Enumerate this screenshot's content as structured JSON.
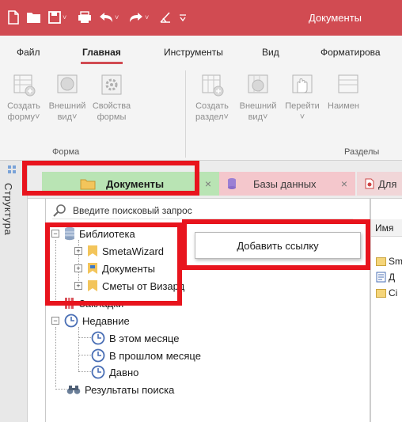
{
  "title_bar": {
    "title": "Документы",
    "quick_access": [
      "new-file-icon",
      "open-folder-icon",
      "save-icon",
      "print-icon",
      "undo-icon",
      "redo-icon",
      "clear-icon",
      "customize-icon"
    ]
  },
  "menu": {
    "tabs": [
      "Файл",
      "Главная",
      "Инструменты",
      "Вид",
      "Форматирова"
    ],
    "active": "Главная"
  },
  "ribbon": {
    "groups": [
      {
        "label": "Форма",
        "buttons": [
          {
            "label": "Создать\nформу˅",
            "icon": "create-form-icon"
          },
          {
            "label": "Внешний\nвид˅",
            "icon": "appearance-icon"
          },
          {
            "label": "Свойства\nформы",
            "icon": "properties-icon"
          }
        ]
      },
      {
        "label": "Разделы",
        "buttons": [
          {
            "label": "Создать\nраздел˅",
            "icon": "create-section-icon"
          },
          {
            "label": "Внешний\nвид˅",
            "icon": "appearance-icon"
          },
          {
            "label": "Перейти\n˅",
            "icon": "go-to-icon"
          },
          {
            "label": "Наимен",
            "icon": "name-icon"
          }
        ]
      }
    ]
  },
  "side_panel": {
    "label": "Структура"
  },
  "tabs": [
    {
      "label": "Документы",
      "close": "×",
      "active": true,
      "color": "#b9e4b4"
    },
    {
      "label": "Базы данных",
      "close": "×",
      "active": false,
      "color": "#f4c7cc"
    },
    {
      "label": "Для",
      "active": false,
      "color": "#f1d6d8"
    }
  ],
  "search": {
    "placeholder": "Введите поисковый запрос"
  },
  "tree": {
    "library": "Библиотека",
    "smeta": "SmetaWizard",
    "documents": "Документы",
    "smety": "Сметы от Визард",
    "bookmarks": "Закладки",
    "recent": "Недавние",
    "this_month": "В этом месяце",
    "last_month": "В прошлом месяце",
    "long_ago": "Давно",
    "search_results": "Результаты поиска"
  },
  "list": {
    "header": "Имя",
    "items": [
      "Sm",
      "Д",
      "Сі"
    ]
  },
  "popup": {
    "label": "Добавить ссылку"
  },
  "colors": {
    "title_bar": "#d14b52",
    "annotation": "#e8141d",
    "active_tab": "#b9e4b4",
    "db_tab": "#f4c7cc"
  }
}
